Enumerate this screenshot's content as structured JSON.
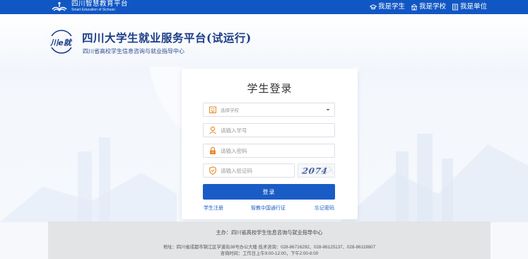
{
  "topbar": {
    "logo_cn": "四川智慧教育平台",
    "logo_en": "Smart Education of Sichuan",
    "nav": [
      {
        "label": "我是学生",
        "icon": "graduation-cap-icon"
      },
      {
        "label": "我是学校",
        "icon": "school-building-icon"
      },
      {
        "label": "我是单位",
        "icon": "office-building-icon"
      }
    ]
  },
  "header": {
    "title": "四川大学生就业服务平台(试运行)",
    "subtitle": "四川省高校学生信息咨询与就业指导中心",
    "logo_text": "川e就"
  },
  "login": {
    "title": "学生登录",
    "school_select": {
      "placeholder": "选择学校",
      "icon": "school-icon"
    },
    "student_id": {
      "placeholder": "请输入学号",
      "icon": "user-icon"
    },
    "password": {
      "placeholder": "请输入密码",
      "icon": "lock-icon"
    },
    "captcha_input": {
      "placeholder": "请输入验证码",
      "icon": "shield-icon"
    },
    "captcha_code": "2074",
    "submit_label": "登录",
    "links": {
      "register": "学生注册",
      "chsi": "智教中国通行证",
      "forgot": "忘记密码"
    }
  },
  "footer": {
    "host": "主办：四川省高校学生信息咨询与就业指导中心",
    "address": "地址：四川省成都市锦江区学道街38号办公大楼   技术咨询：028-86716292、028-86125137、028-86119607",
    "hours": "咨询时间：工作日上午9:00-12:00，下午2:00-6:00"
  },
  "colors": {
    "primary": "#1a5cc6",
    "topbar": "#1157c4",
    "brand_title": "#1b3d86",
    "icon_orange": "#e8892b"
  }
}
